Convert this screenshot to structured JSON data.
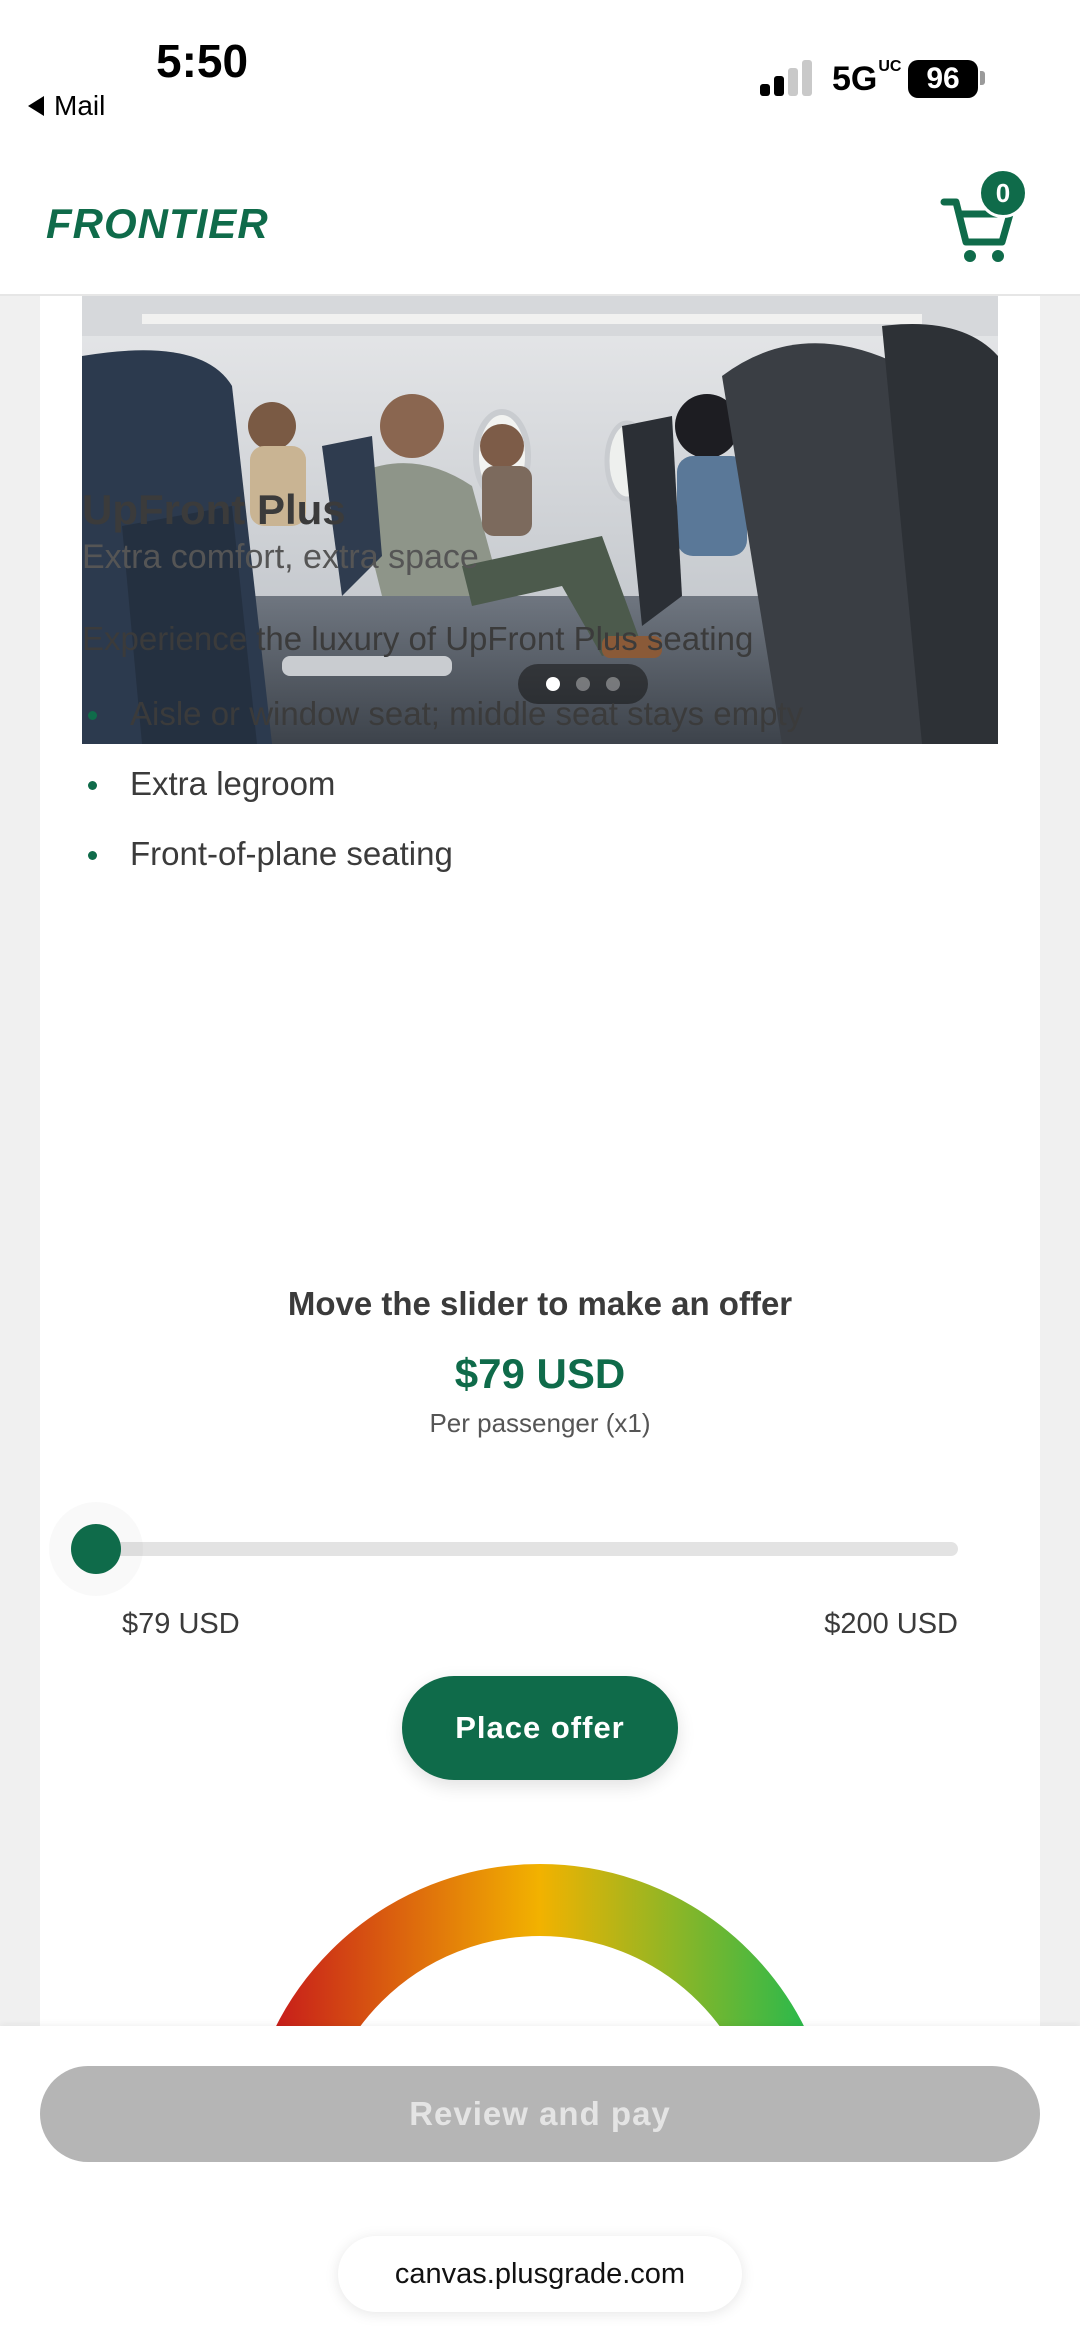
{
  "status_bar": {
    "time": "5:50",
    "back_label": "Mail",
    "network": "5G",
    "network_suffix": "UC",
    "battery": "96"
  },
  "header": {
    "logo": "FRONTIER",
    "cart_count": "0"
  },
  "product": {
    "title": "UpFront Plus",
    "subtitle": "Extra comfort, extra space",
    "intro": "Experience the luxury of UpFront Plus seating",
    "features": [
      "Aisle or window seat; middle seat stays empty",
      "Extra legroom",
      "Front-of-plane seating"
    ],
    "carousel": {
      "slides": 3,
      "active": 1
    }
  },
  "offer": {
    "prompt": "Move the slider to make an offer",
    "price": "$79 USD",
    "per_passenger": "Per passenger (x1)",
    "min_label": "$79 USD",
    "max_label": "$200 USD",
    "min_value": 79,
    "max_value": 200,
    "current_value": 79,
    "place_offer_label": "Place offer"
  },
  "footer": {
    "review_pay_label": "Review and pay",
    "url": "canvas.plusgrade.com"
  },
  "colors": {
    "brand_green": "#0f6b4a",
    "disabled_button": "#b5b5b5",
    "gauge_low": "#c8201a",
    "gauge_mid": "#f2b200",
    "gauge_high": "#2fb94a"
  }
}
